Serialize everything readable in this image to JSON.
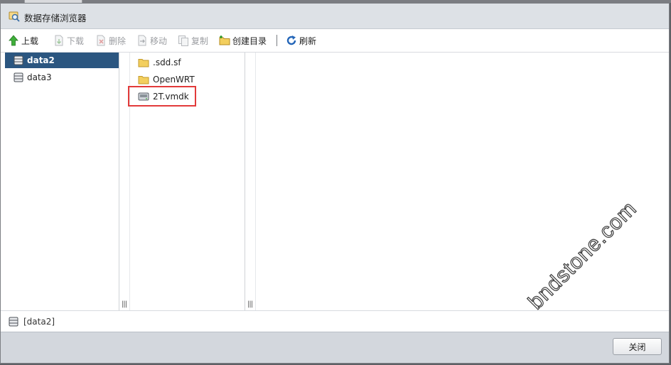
{
  "dialog": {
    "title": "数据存储浏览器"
  },
  "toolbar": {
    "upload": {
      "label": "上载",
      "icon": "upload-arrow-icon",
      "enabled": true
    },
    "download": {
      "label": "下载",
      "icon": "download-icon",
      "enabled": false
    },
    "delete": {
      "label": "删除",
      "icon": "delete-icon",
      "enabled": false
    },
    "move": {
      "label": "移动",
      "icon": "move-icon",
      "enabled": false
    },
    "copy": {
      "label": "复制",
      "icon": "copy-icon",
      "enabled": false
    },
    "create_dir": {
      "label": "创建目录",
      "icon": "new-folder-icon",
      "enabled": true
    },
    "refresh": {
      "label": "刷新",
      "icon": "refresh-icon",
      "enabled": true
    }
  },
  "datastores": [
    {
      "label": "data2",
      "selected": true
    },
    {
      "label": "data3",
      "selected": false
    }
  ],
  "files": [
    {
      "label": ".sdd.sf",
      "type": "folder"
    },
    {
      "label": "OpenWRT",
      "type": "folder"
    },
    {
      "label": "2T.vmdk",
      "type": "disk",
      "highlighted": true
    }
  ],
  "status": {
    "path": "[data2]"
  },
  "footer": {
    "close_label": "关闭"
  },
  "watermark": "bndstone.com",
  "colors": {
    "selected_bg": "#2b5680",
    "highlight_border": "#e23a3a",
    "titlebar_bg": "#dde1e6",
    "footer_bg": "#d3d7dd"
  }
}
